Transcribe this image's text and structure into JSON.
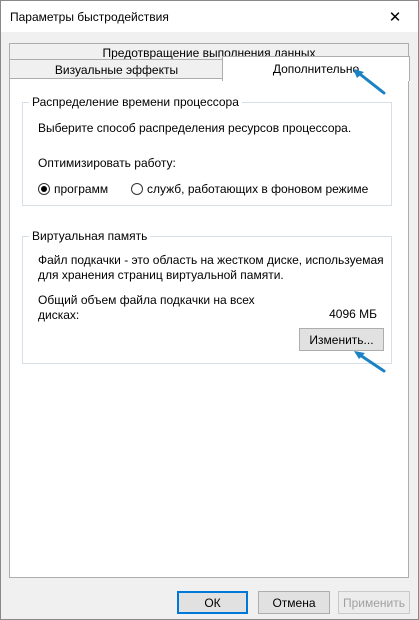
{
  "window": {
    "title": "Параметры быстродействия"
  },
  "tabs": {
    "back": "Предотвращение выполнения данных",
    "visual": "Визуальные эффекты",
    "advanced": "Дополнительно"
  },
  "processor": {
    "legend": "Распределение времени процессора",
    "description": "Выберите способ распределения ресурсов процессора.",
    "optimize_label": "Оптимизировать работу:",
    "option_programs": "программ",
    "option_services": "служб, работающих в фоновом режиме",
    "selected": "programs"
  },
  "virtual_memory": {
    "legend": "Виртуальная память",
    "description_line1": "Файл подкачки - это область на жестком диске, используемая",
    "description_line2": "для хранения страниц виртуальной памяти.",
    "total_line1": "Общий объем файла подкачки на всех",
    "total_line2": "дисках:",
    "total_value": "4096 МБ",
    "change_button": "Изменить..."
  },
  "buttons": {
    "ok": "ОК",
    "cancel": "Отмена",
    "apply": "Применить"
  },
  "colors": {
    "arrow": "#1c82c4",
    "accent": "#0078d7"
  }
}
